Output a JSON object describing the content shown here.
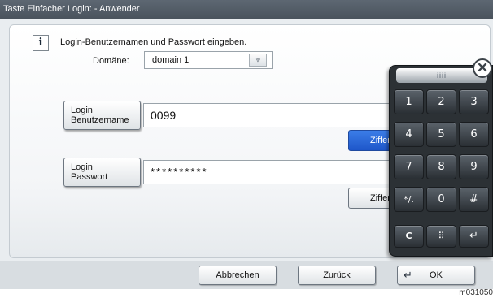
{
  "title": {
    "main": "Taste Einfacher Login:",
    "sep": "-",
    "user": "Anwender"
  },
  "info": {
    "icon": "info-icon",
    "text": "Login-Benutzernamen und Passwort eingeben."
  },
  "domain": {
    "label": "Domäne:",
    "value": "domain 1",
    "arrow": "⩔"
  },
  "username": {
    "label_line1": "Login",
    "label_line2": "Benutzername",
    "value": "0099",
    "keys_button": "Zifferntasten"
  },
  "password": {
    "label_line1": "Login",
    "label_line2": "Passwort",
    "value": "**********",
    "keys_button": "Zifferntasten"
  },
  "keypad": {
    "close": "✕",
    "handle": "iiii",
    "keys": [
      "1",
      "2",
      "3",
      "4",
      "5",
      "6",
      "7",
      "8",
      "9",
      "*/.",
      "0",
      "#",
      "C",
      "⠿",
      "↵"
    ]
  },
  "footer": {
    "cancel": "Abbrechen",
    "back": "Zurück",
    "ok_icon": "↵",
    "ok": "OK"
  },
  "caption": "m031050"
}
